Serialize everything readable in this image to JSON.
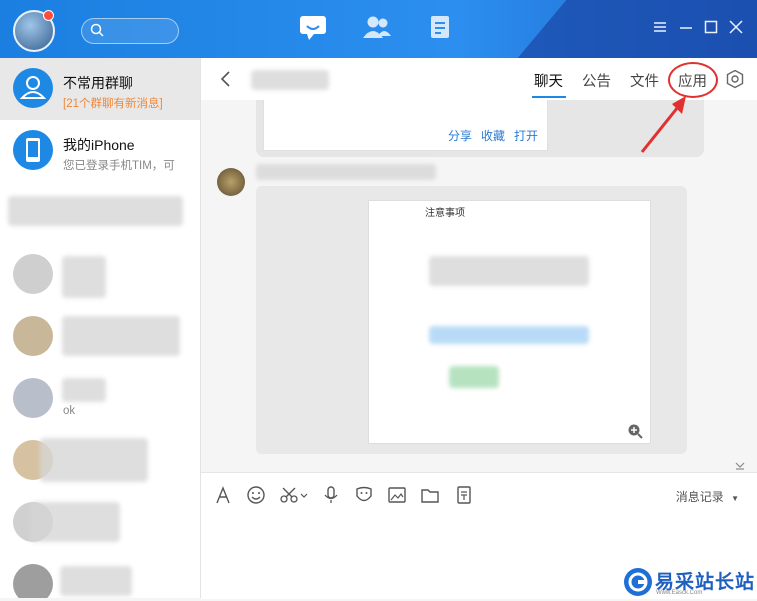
{
  "conversations": [
    {
      "title": "不常用群聊",
      "subtitle": "[21个群聊有新消息]",
      "icon": "group-icon"
    },
    {
      "title": "我的iPhone",
      "subtitle": "您已登录手机TIM，可",
      "icon": "phone-icon"
    },
    {
      "title": "",
      "subtitle": ""
    },
    {
      "title": "",
      "subtitle": ""
    },
    {
      "title": "",
      "subtitle": ""
    },
    {
      "title": "",
      "subtitle": "ok"
    },
    {
      "title": "",
      "subtitle": ""
    },
    {
      "title": "",
      "subtitle": ""
    },
    {
      "title": "",
      "subtitle": ""
    }
  ],
  "header": {
    "back_icon": "chevron-left-icon",
    "tabs": [
      {
        "label": "聊天",
        "active": true
      },
      {
        "label": "公告",
        "active": false
      },
      {
        "label": "文件",
        "active": false
      },
      {
        "label": "应用",
        "active": false
      }
    ],
    "settings_icon": "settings-icon"
  },
  "card": {
    "actions": [
      "分享",
      "收藏",
      "打开"
    ]
  },
  "shared_image": {
    "heading": "注意事项"
  },
  "toolbar": {
    "icons": [
      "font-icon",
      "emoji-icon",
      "screenshot-icon",
      "mic-icon",
      "sticker-icon",
      "image-icon",
      "folder-icon",
      "doc-icon"
    ],
    "history_label": "消息记录"
  },
  "annotation": {
    "color": "#e23030"
  },
  "watermark": {
    "text": "易采站长站",
    "url": "Www.Easck.Com"
  },
  "colors": {
    "accent": "#1e88e5",
    "topbar": "#2c8ff0",
    "unread": "#f0883a"
  }
}
